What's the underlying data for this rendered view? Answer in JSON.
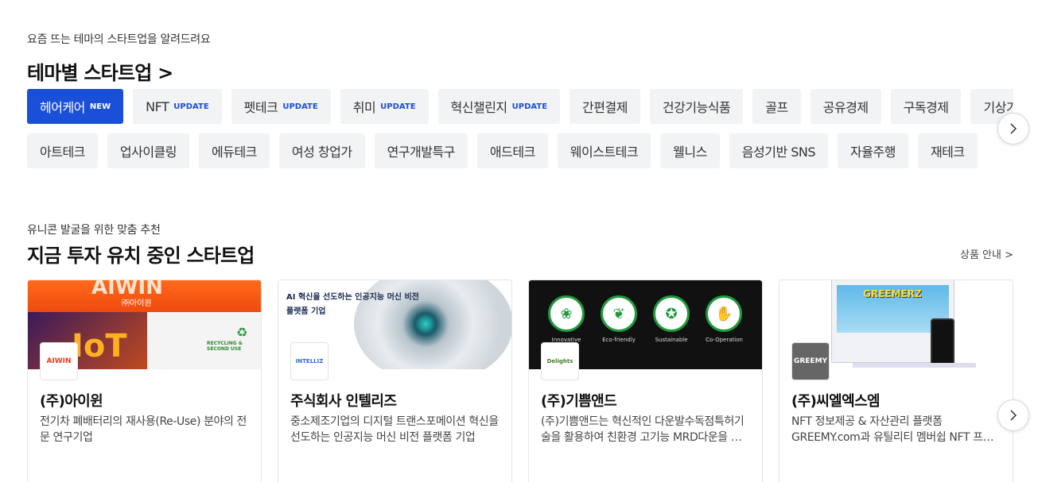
{
  "theme_section": {
    "eyebrow": "요즘 뜨는 테마의 스타트업을 알려드려요",
    "title": "테마별 스타트업 >",
    "row1": [
      {
        "label": "헤어케어",
        "badge": "NEW",
        "active": true
      },
      {
        "label": "NFT",
        "badge": "UPDATE"
      },
      {
        "label": "펫테크",
        "badge": "UPDATE"
      },
      {
        "label": "취미",
        "badge": "UPDATE"
      },
      {
        "label": "혁신챌린지",
        "badge": "UPDATE"
      },
      {
        "label": "간편결제"
      },
      {
        "label": "건강기능식품"
      },
      {
        "label": "골프"
      },
      {
        "label": "공유경제"
      },
      {
        "label": "구독경제"
      },
      {
        "label": "기상기후"
      }
    ],
    "row2": [
      {
        "label": "아트테크"
      },
      {
        "label": "업사이클링"
      },
      {
        "label": "에듀테크"
      },
      {
        "label": "여성 창업가"
      },
      {
        "label": "연구개발특구"
      },
      {
        "label": "애드테크"
      },
      {
        "label": "웨이스트테크"
      },
      {
        "label": "웰니스"
      },
      {
        "label": "음성기반 SNS"
      },
      {
        "label": "자율주행"
      },
      {
        "label": "재테크"
      }
    ]
  },
  "invest_section": {
    "eyebrow": "유니콘 발굴을 위한 맞춤 추천",
    "title": "지금 투자 유치 중인 스타트업",
    "more_link": "상품 안내 >",
    "cards": [
      {
        "name": "(주)아이윈",
        "desc": "전기차 폐배터리의 재사용(Re-Use) 분야의 전문 연구기업",
        "logo": "AIWIN",
        "banner_title": "AIWIN",
        "banner_sub": "㈜아이윈",
        "banner_text": "RECYCLING & SECOND USE",
        "banner_iot": "IoT"
      },
      {
        "name": "주식회사 인텔리즈",
        "desc": "중소제조기업의 디지털 트랜스포메이션 혁신을 선도하는 인공지능 머신 비전 플랫폼 기업",
        "logo": "INTELLIZ",
        "banner_text1": "AI 혁신을 선도하는 인공지능 머신 비전",
        "banner_text2": "플랫폼 기업"
      },
      {
        "name": "(주)기쁨앤드",
        "desc": "(주)기쁨앤드는 혁신적인 다운발수독점특허기술을 활용하여 친환경 고기능 MRD다운을 생산합니다",
        "logo": "Delights",
        "certs": [
          "Innovative",
          "Eco-friendly",
          "Sustainable",
          "Co-Operation"
        ]
      },
      {
        "name": "(주)씨엘엑스엠",
        "desc": "NFT 정보제공 & 자산관리 플랫폼 GREEMY.com과 유틸리티 멤버쉽 NFT 프로젝트",
        "logo": "GREEMY",
        "banner_text": "GREEMERZ"
      }
    ]
  },
  "colors": {
    "accent": "#1a4fd7",
    "chip_bg": "#f2f3f5"
  }
}
